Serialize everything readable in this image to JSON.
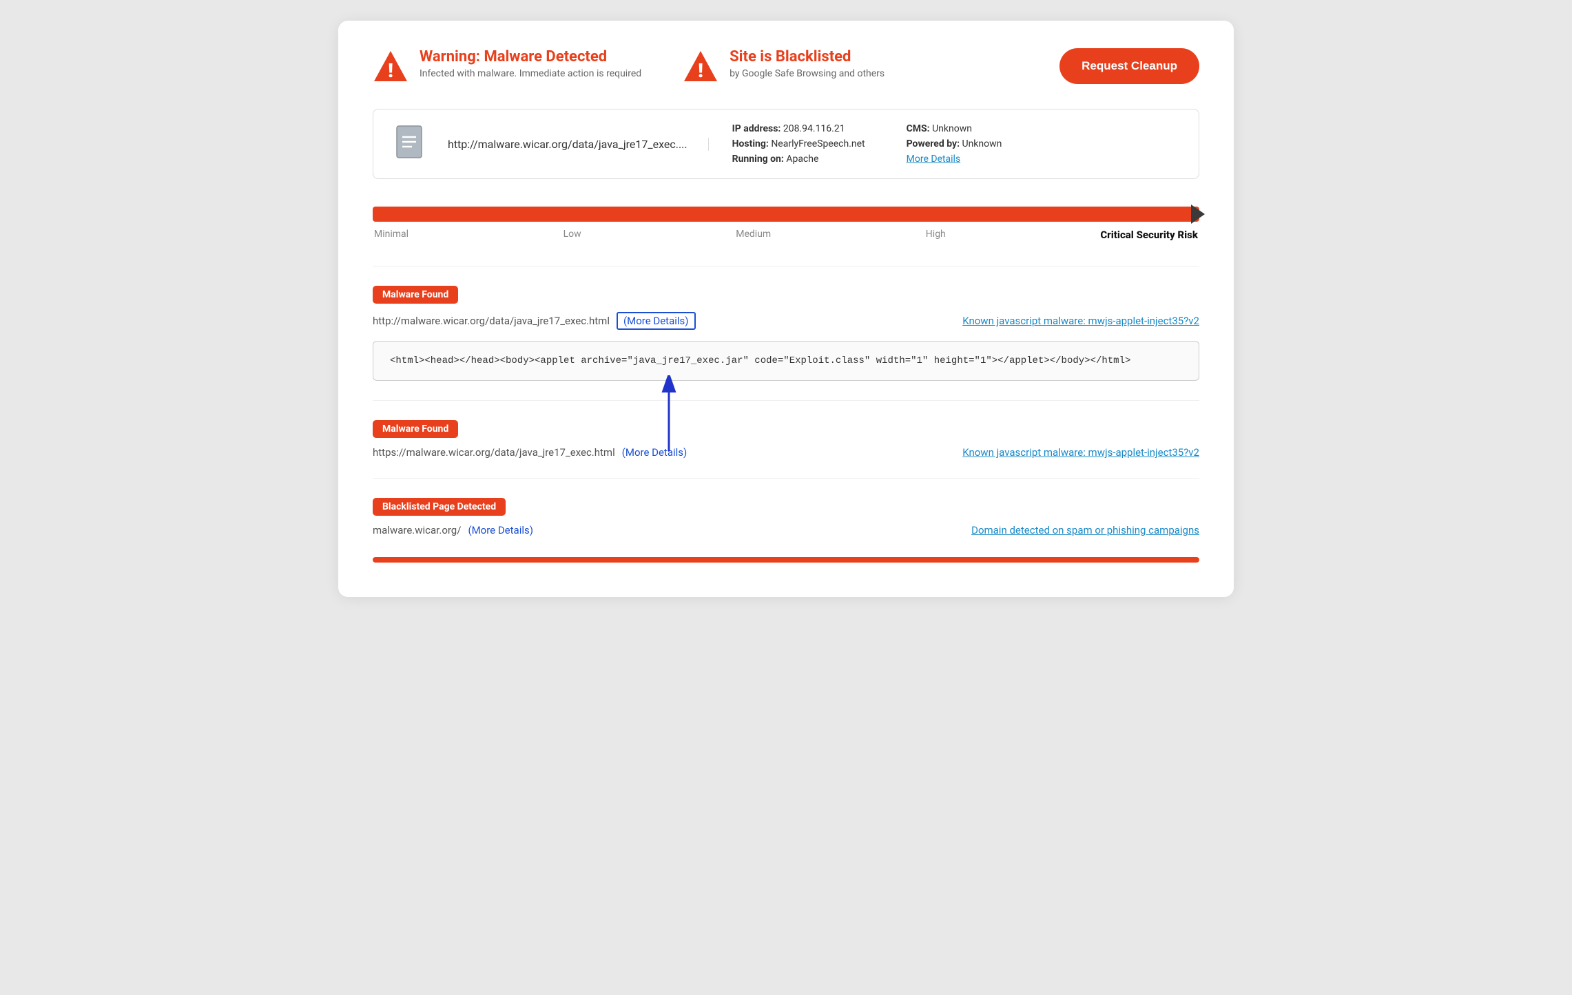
{
  "header": {
    "warning1": {
      "title": "Warning: Malware Detected",
      "subtitle": "Infected with malware. Immediate action is required"
    },
    "warning2": {
      "title": "Site is Blacklisted",
      "subtitle": "by Google Safe Browsing and others"
    },
    "cleanup_button": "Request Cleanup"
  },
  "site_info": {
    "url": "http://malware.wicar.org/data/java_jre17_exec....",
    "ip_label": "IP address:",
    "ip_value": "208.94.116.21",
    "hosting_label": "Hosting:",
    "hosting_value": "NearlyFreeSpeech.net",
    "running_label": "Running on:",
    "running_value": "Apache",
    "cms_label": "CMS:",
    "cms_value": "Unknown",
    "powered_label": "Powered by:",
    "powered_value": "Unknown",
    "more_details": "More Details"
  },
  "risk_bar": {
    "labels": [
      "Minimal",
      "Low",
      "Medium",
      "High",
      "Critical Security Risk"
    ]
  },
  "findings": [
    {
      "id": "finding1",
      "badge": "Malware Found",
      "url": "http://malware.wicar.org/data/java_jre17_exec.html",
      "more_details_label": "(More Details)",
      "known_link": "Known javascript malware: mwjs-applet-inject35?v2",
      "code": "<html><head></head><body><applet archive=\"java_jre17_exec.jar\" code=\"Exploit.class\" width=\"1\" height=\"1\"></applet></body></html>",
      "has_code": true,
      "has_arrow": true
    },
    {
      "id": "finding2",
      "badge": "Malware Found",
      "url": "https://malware.wicar.org/data/java_jre17_exec.html",
      "more_details_label": "(More Details)",
      "known_link": "Known javascript malware: mwjs-applet-inject35?v2",
      "has_code": false,
      "has_arrow": false
    },
    {
      "id": "finding3",
      "badge": "Blacklisted Page Detected",
      "url": "malware.wicar.org/",
      "more_details_label": "(More Details)",
      "known_link": "Domain detected on spam or phishing campaigns",
      "has_code": false,
      "has_arrow": false
    }
  ],
  "icons": {
    "warning_triangle": "⚠",
    "document": "📄"
  }
}
